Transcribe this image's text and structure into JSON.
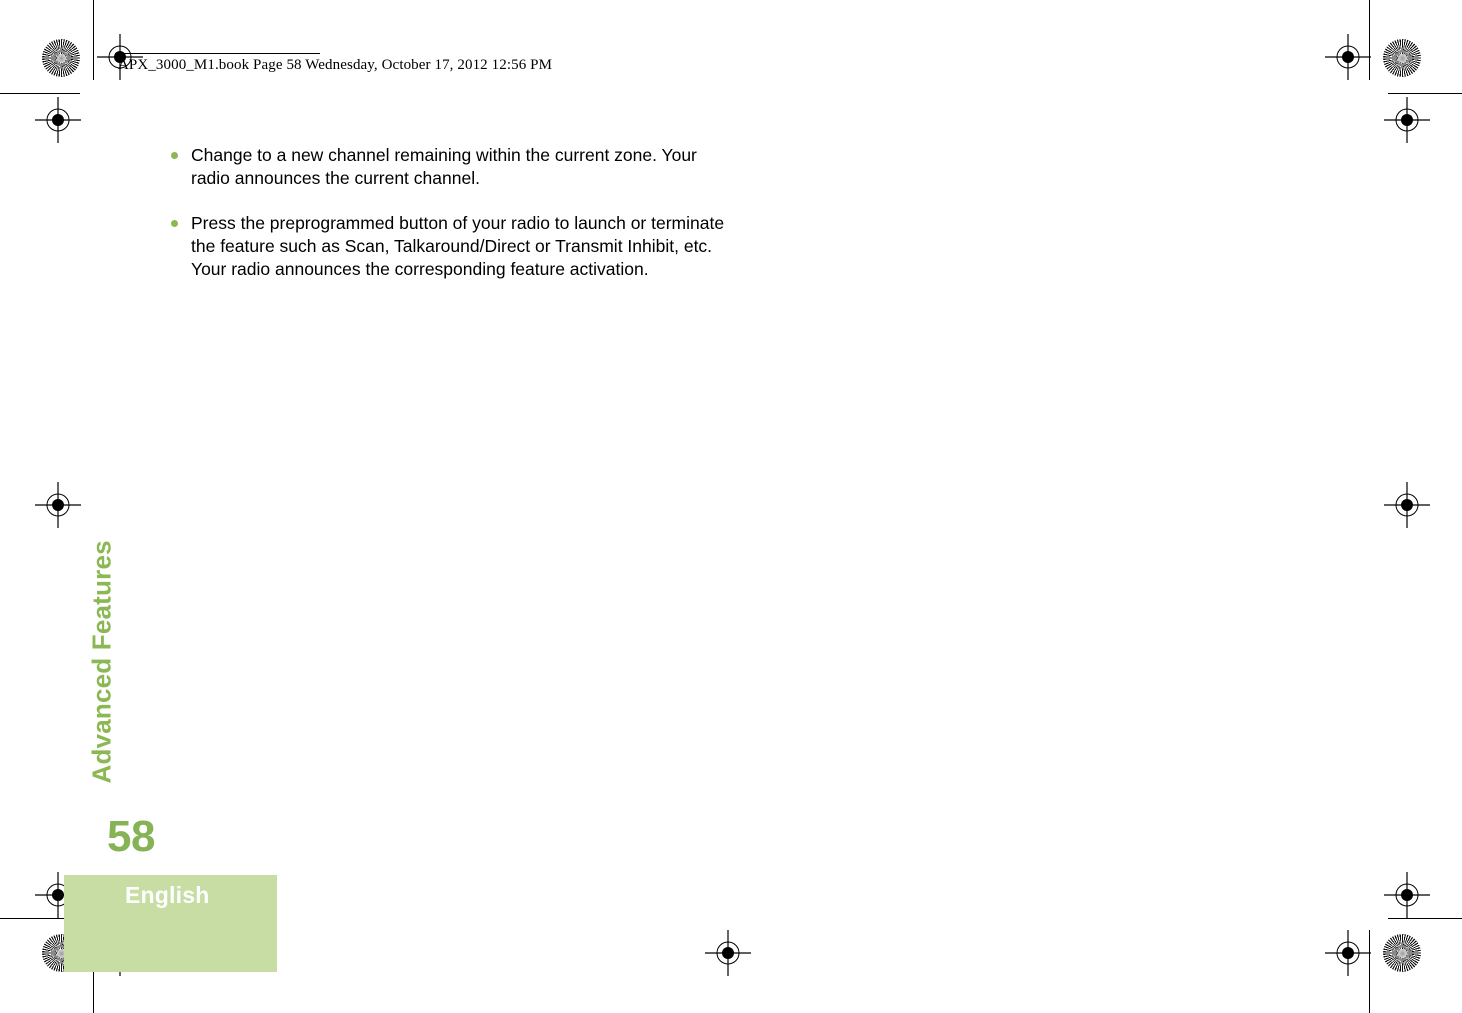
{
  "document": {
    "header": {
      "filename": "APX_3000_M1.book",
      "page_label": "Page 58",
      "date": "Wednesday, October 17, 2012",
      "time": "12:56 PM",
      "full_text": "APX_3000_M1.book  Page 58  Wednesday, October 17, 2012  12:56 PM"
    },
    "chapter_tab": "Advanced Features",
    "body": {
      "bullets": [
        "Change to a new channel remaining within the current zone. Your radio announces the current channel.",
        "Press the preprogrammed button of your radio to launch or terminate the feature such as Scan, Talkaround/Direct or Transmit Inhibit, etc. Your radio announces the corresponding feature activation."
      ]
    },
    "footer": {
      "page_number": "58",
      "language": "English"
    },
    "colors": {
      "accent_green": "#8cb854",
      "page_number_green": "#85b356",
      "language_box": "#c8dda4",
      "bullet_dot": "#8cb854",
      "text": "#000000",
      "language_label": "#ffffff"
    }
  }
}
